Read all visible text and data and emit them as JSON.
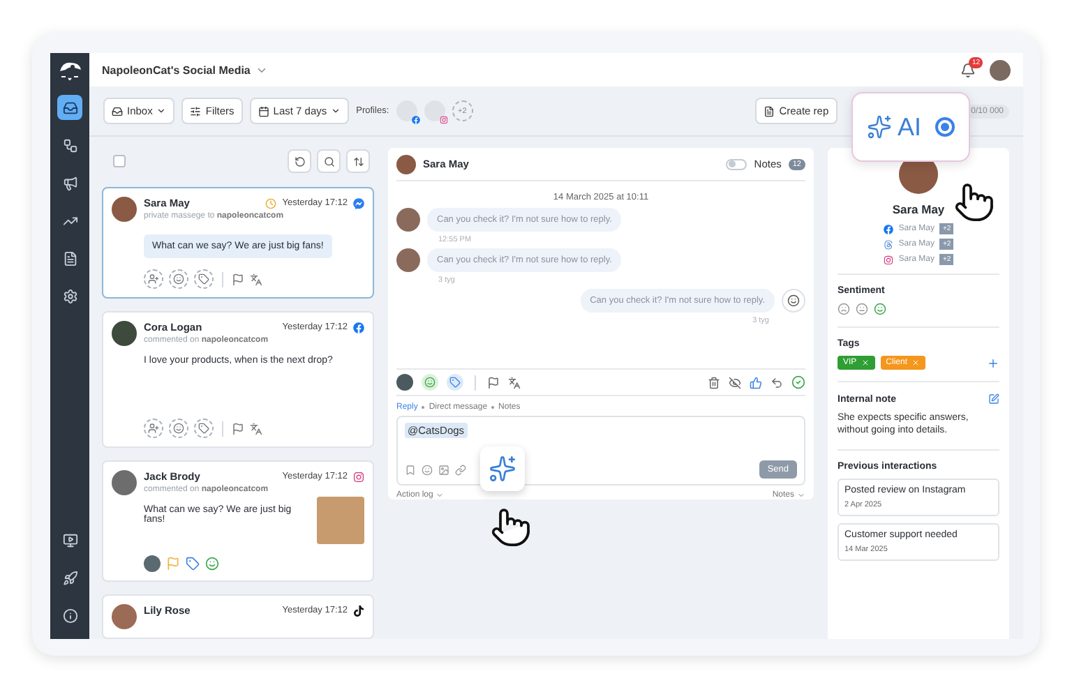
{
  "nav": {
    "items": [
      {
        "kind": "inbox",
        "selected": true
      },
      {
        "kind": "automation",
        "selected": false
      },
      {
        "kind": "campaigns",
        "selected": false
      },
      {
        "kind": "analytics",
        "selected": false
      },
      {
        "kind": "reports",
        "selected": false
      },
      {
        "kind": "settings",
        "selected": false
      }
    ],
    "bottom": [
      {
        "kind": "video"
      },
      {
        "kind": "rocket"
      },
      {
        "kind": "info"
      }
    ]
  },
  "header": {
    "title": "NapoleonCat's Social Media",
    "notifications": "12"
  },
  "toolbar": {
    "inbox": "Inbox",
    "filters": "Filters",
    "date_range": "Last 7 days",
    "profiles_label": "Profiles:",
    "profiles": [
      {
        "kind": "facebook"
      },
      {
        "kind": "instagram"
      }
    ],
    "more_profiles": "+2",
    "create_report": "Create rep",
    "counter": "0/10 000"
  },
  "ai_popup": {
    "label": "AI",
    "selected": true
  },
  "list": {
    "select_all": false,
    "items": [
      {
        "name": "Sara May",
        "kind": "messenger",
        "bubble": true,
        "pending": true,
        "selected": true,
        "verb": "private massege to",
        "account": "napoleoncatcom",
        "time": "Yesterday 17:12",
        "text": "What can we say? We are just big fans!",
        "actions_set": false,
        "photo": false
      },
      {
        "name": "Cora Logan",
        "kind": "facebook",
        "bubble": false,
        "pending": false,
        "selected": false,
        "verb": "commented on",
        "account": "napoleoncatcom",
        "time": "Yesterday 17:12",
        "text": "I love your products, when is the next drop?",
        "actions_set": false,
        "photo": false
      },
      {
        "name": "Jack Brody",
        "kind": "instagram",
        "bubble": false,
        "pending": false,
        "selected": false,
        "verb": "commented on",
        "account": "napoleoncatcom",
        "time": "Yesterday 17:12",
        "text": "What can we say? We are just big fans!",
        "actions_set": true,
        "photo": true
      },
      {
        "name": "Lily Rose",
        "kind": "tiktok",
        "selected": false,
        "time": "Yesterday 17:12"
      }
    ]
  },
  "conversation": {
    "name": "Sara May",
    "notes_on": false,
    "notes_label": "Notes",
    "notes_count": "12",
    "date": "14 March 2025 at 10:11",
    "messages": [
      {
        "kind": "in",
        "text": "Can you check it? I'm not sure how to reply.",
        "time": "12:55 PM"
      },
      {
        "kind": "in",
        "text": "Can you check it? I'm not sure how to reply.",
        "time": "3 tyg"
      },
      {
        "kind": "out",
        "text": "Can you check it? I'm not sure how to reply.",
        "time": "3 tyg"
      }
    ],
    "reply_tabs": [
      {
        "label": "Reply",
        "selected": true
      },
      {
        "label": "Direct message",
        "selected": false
      },
      {
        "label": "Notes",
        "selected": false
      }
    ],
    "compose_value": "@CatsDogs",
    "send": "Send",
    "send_disabled": true,
    "action_log": "Action log",
    "notes_menu": "Notes"
  },
  "contact": {
    "name": "Sara May",
    "profiles": [
      {
        "kind": "facebook",
        "name": "Sara May",
        "count": "+2"
      },
      {
        "kind": "threads",
        "name": "Sara May",
        "count": "+2"
      },
      {
        "kind": "instagram",
        "name": "Sara May",
        "count": "+2"
      }
    ],
    "sentiment_title": "Sentiment",
    "sentiment": [
      {
        "kind": "negative",
        "selected": false
      },
      {
        "kind": "neutral",
        "selected": false
      },
      {
        "kind": "positive",
        "selected": true
      }
    ],
    "tags_title": "Tags",
    "tags": [
      {
        "label": "VIP",
        "color": "#2f9e33"
      },
      {
        "label": "Client",
        "color": "#f5961d"
      }
    ],
    "note_title": "Internal note",
    "note": "She expects specific answers, without going into details.",
    "history_title": "Previous interactions",
    "history": [
      {
        "title": "Posted review on Instagram",
        "date": "2 Apr 2025"
      },
      {
        "title": "Customer support needed",
        "date": "14 Mar 2025"
      }
    ]
  }
}
